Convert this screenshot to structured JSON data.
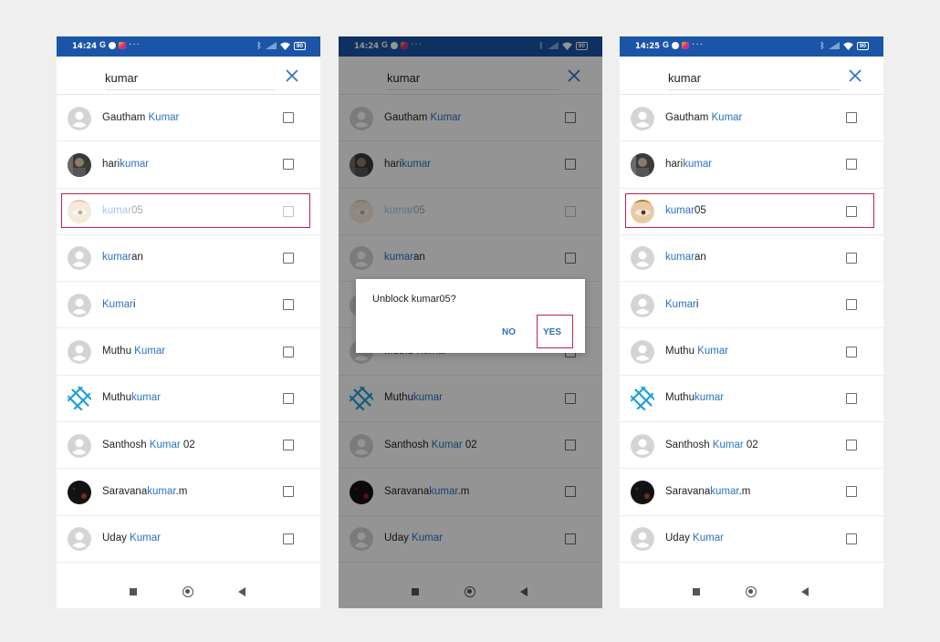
{
  "search": {
    "query": "kumar"
  },
  "dialog": {
    "message": "Unblock kumar05?",
    "no_label": "NO",
    "yes_label": "YES"
  },
  "phones": [
    {
      "time": "14:24",
      "battery": "90"
    },
    {
      "time": "14:24",
      "battery": "90"
    },
    {
      "time": "14:25",
      "battery": "90"
    }
  ],
  "status_apps": [
    "G",
    "facebook-icon",
    "instagram-icon",
    "more-icon"
  ],
  "contacts": [
    {
      "pre": "Gautham ",
      "match": "Kumar",
      "post": "",
      "avatar": "default"
    },
    {
      "pre": "hari",
      "match": "kumar",
      "post": "",
      "avatar": "photo-man"
    },
    {
      "pre": "",
      "match": "kumar",
      "post": "05",
      "avatar": "photo-eye"
    },
    {
      "pre": "",
      "match": "kumar",
      "post": "an",
      "avatar": "default"
    },
    {
      "pre": "",
      "match": "Kumar",
      "post": "i",
      "avatar": "default"
    },
    {
      "pre": "Muthu ",
      "match": "Kumar",
      "post": "",
      "avatar": "default"
    },
    {
      "pre": "Muthu",
      "match": "kumar",
      "post": "",
      "avatar": "photo-blue-pattern"
    },
    {
      "pre": "Santhosh ",
      "match": "Kumar",
      "post": " 02",
      "avatar": "default"
    },
    {
      "pre": "Saravana",
      "match": "kumar",
      "post": ".m",
      "avatar": "photo-dark"
    },
    {
      "pre": "Uday ",
      "match": "Kumar",
      "post": "",
      "avatar": "default"
    }
  ],
  "colors": {
    "statusbar": "#1b55a8",
    "accent": "#2a72c2",
    "highlight_box": "#c0224a"
  }
}
